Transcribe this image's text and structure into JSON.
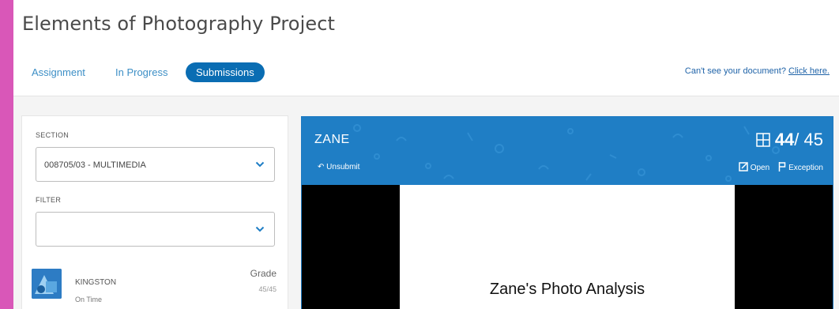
{
  "page": {
    "title": "Elements of Photography Project"
  },
  "tabs": [
    {
      "label": "Assignment",
      "active": false
    },
    {
      "label": "In Progress",
      "active": false
    },
    {
      "label": "Submissions",
      "active": true
    }
  ],
  "help": {
    "text": "Can't see your document?",
    "link": "Click here."
  },
  "panel": {
    "section_label": "SECTION",
    "section_value": "008705/03 - MULTIMEDIA",
    "filter_label": "FILTER",
    "filter_value": "",
    "student": {
      "name": "KINGSTON",
      "status": "On Time",
      "grade_label": "Grade",
      "grade": "45/45"
    }
  },
  "viewer": {
    "student_name": "ZANE",
    "unsubmit_label": "Unsubmit",
    "score": "44",
    "total": "/ 45",
    "open_label": "Open",
    "exception_label": "Exception",
    "document_title": "Zane's Photo Analysis"
  },
  "colors": {
    "accent": "#1f7ec5",
    "tab_active": "#0a6db3",
    "frame": "#d957b8"
  }
}
